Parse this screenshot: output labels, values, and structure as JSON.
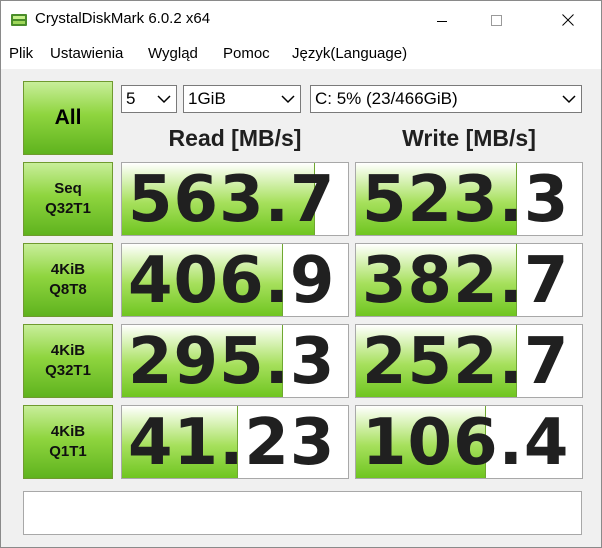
{
  "window": {
    "title": "CrystalDiskMark 6.0.2 x64"
  },
  "menu": [
    "Plik",
    "Ustawienia",
    "Wygląd",
    "Pomoc",
    "Język(Language)"
  ],
  "controls": {
    "all_label": "All",
    "count": "5",
    "size": "1GiB",
    "drive": "C: 5% (23/466GiB)"
  },
  "headers": {
    "read": "Read [MB/s]",
    "write": "Write [MB/s]"
  },
  "rows": [
    {
      "line1": "Seq",
      "line2": "Q32T1",
      "read": "563.7",
      "write": "523.3",
      "read_level": 0.85,
      "write_level": 0.71
    },
    {
      "line1": "4KiB",
      "line2": "Q8T8",
      "read": "406.9",
      "write": "382.7",
      "read_level": 0.71,
      "write_level": 0.71
    },
    {
      "line1": "4KiB",
      "line2": "Q32T1",
      "read": "295.3",
      "write": "252.7",
      "read_level": 0.71,
      "write_level": 0.71
    },
    {
      "line1": "4KiB",
      "line2": "Q1T1",
      "read": "41.23",
      "write": "106.4",
      "read_level": 0.51,
      "write_level": 0.57
    }
  ],
  "comment": "",
  "colors": {
    "accent_green": "#6fc520",
    "text_dark": "#202020"
  }
}
